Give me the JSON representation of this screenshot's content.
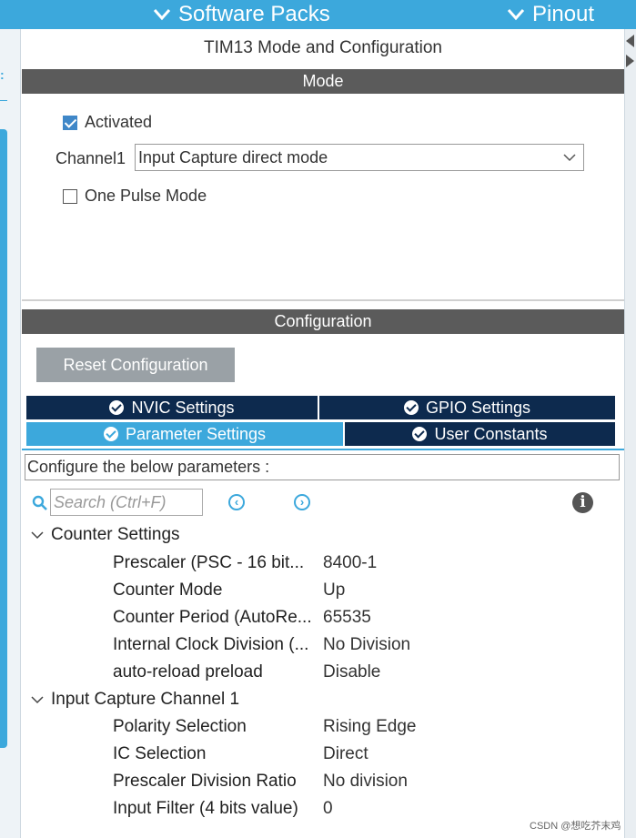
{
  "topbar": {
    "software_packs": "Software Packs",
    "pinout": "Pinout"
  },
  "panel": {
    "title": "TIM13 Mode and Configuration",
    "mode_header": "Mode",
    "config_header": "Configuration"
  },
  "mode": {
    "activated_label": "Activated",
    "activated_checked": true,
    "channel1_label": "Channel1",
    "channel1_value": "Input Capture direct mode",
    "one_pulse_label": "One Pulse Mode",
    "one_pulse_checked": false
  },
  "config": {
    "reset_label": "Reset Configuration",
    "tabs": [
      {
        "label": "NVIC Settings",
        "active": false
      },
      {
        "label": "GPIO Settings",
        "active": false
      },
      {
        "label": "Parameter Settings",
        "active": true
      },
      {
        "label": "User Constants",
        "active": false
      }
    ],
    "describe": "Configure the below parameters :",
    "search_placeholder": "Search (Ctrl+F)"
  },
  "groups": [
    {
      "name": "Counter Settings",
      "params": [
        {
          "label": "Prescaler (PSC - 16 bit...",
          "value": "8400-1"
        },
        {
          "label": "Counter Mode",
          "value": "Up"
        },
        {
          "label": "Counter Period (AutoRe...",
          "value": "65535"
        },
        {
          "label": "Internal Clock Division (...",
          "value": "No Division"
        },
        {
          "label": "auto-reload preload",
          "value": "Disable"
        }
      ]
    },
    {
      "name": "Input Capture Channel 1",
      "params": [
        {
          "label": "Polarity Selection",
          "value": "Rising Edge"
        },
        {
          "label": "IC Selection",
          "value": "Direct"
        },
        {
          "label": "Prescaler Division Ratio",
          "value": "No division"
        },
        {
          "label": "Input Filter (4 bits value)",
          "value": "0"
        }
      ]
    }
  ],
  "watermark": "CSDN @想吃芥末鸡",
  "colors": {
    "accent": "#3ca8dc",
    "tab_dark": "#0d2a4e",
    "header_gray": "#5b5b5b",
    "button_gray": "#9aa1a6"
  }
}
